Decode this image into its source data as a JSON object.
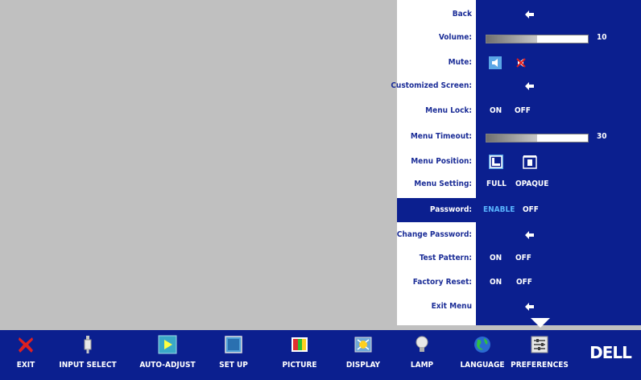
{
  "osd": {
    "rows": [
      {
        "label": "Back"
      },
      {
        "label": "Volume:",
        "value": 10,
        "value_text": "10"
      },
      {
        "label": "Mute:"
      },
      {
        "label": "Customized Screen:"
      },
      {
        "label": "Menu Lock:",
        "opt1": "ON",
        "opt2": "OFF"
      },
      {
        "label": "Menu Timeout:",
        "value": 30,
        "value_text": "30"
      },
      {
        "label": "Menu Position:"
      },
      {
        "label": "Menu Setting:",
        "opt1": "FULL",
        "opt2": "OPAQUE"
      },
      {
        "label": "Password:",
        "opt1": "ENABLE",
        "opt2": "OFF",
        "selected": true
      },
      {
        "label": "Change Password:"
      },
      {
        "label": "Test Pattern:",
        "opt1": "ON",
        "opt2": "OFF"
      },
      {
        "label": "Factory Reset:",
        "opt1": "ON",
        "opt2": "OFF"
      },
      {
        "label": "Exit Menu"
      }
    ],
    "volume_fill_fraction": 0.5,
    "timeout_fill_fraction": 0.5
  },
  "menubar": {
    "items": [
      {
        "label": "EXIT",
        "icon": "exit-x-icon"
      },
      {
        "label": "INPUT SELECT",
        "icon": "input-connector-icon"
      },
      {
        "label": "AUTO-ADJUST",
        "icon": "auto-adjust-play-icon"
      },
      {
        "label": "SET UP",
        "icon": "setup-screen-icon"
      },
      {
        "label": "PICTURE",
        "icon": "picture-color-icon"
      },
      {
        "label": "DISPLAY",
        "icon": "display-icon"
      },
      {
        "label": "LAMP",
        "icon": "lamp-bulb-icon"
      },
      {
        "label": "LANGUAGE",
        "icon": "language-globe-icon"
      },
      {
        "label": "PREFERENCES",
        "icon": "preferences-sliders-icon"
      }
    ],
    "logo": "DELL"
  },
  "colors": {
    "background": "#c0c0c0",
    "panel_blue": "#0b1f8f",
    "label_blue": "#1b2d97",
    "enable_blue": "#58b4ff"
  }
}
